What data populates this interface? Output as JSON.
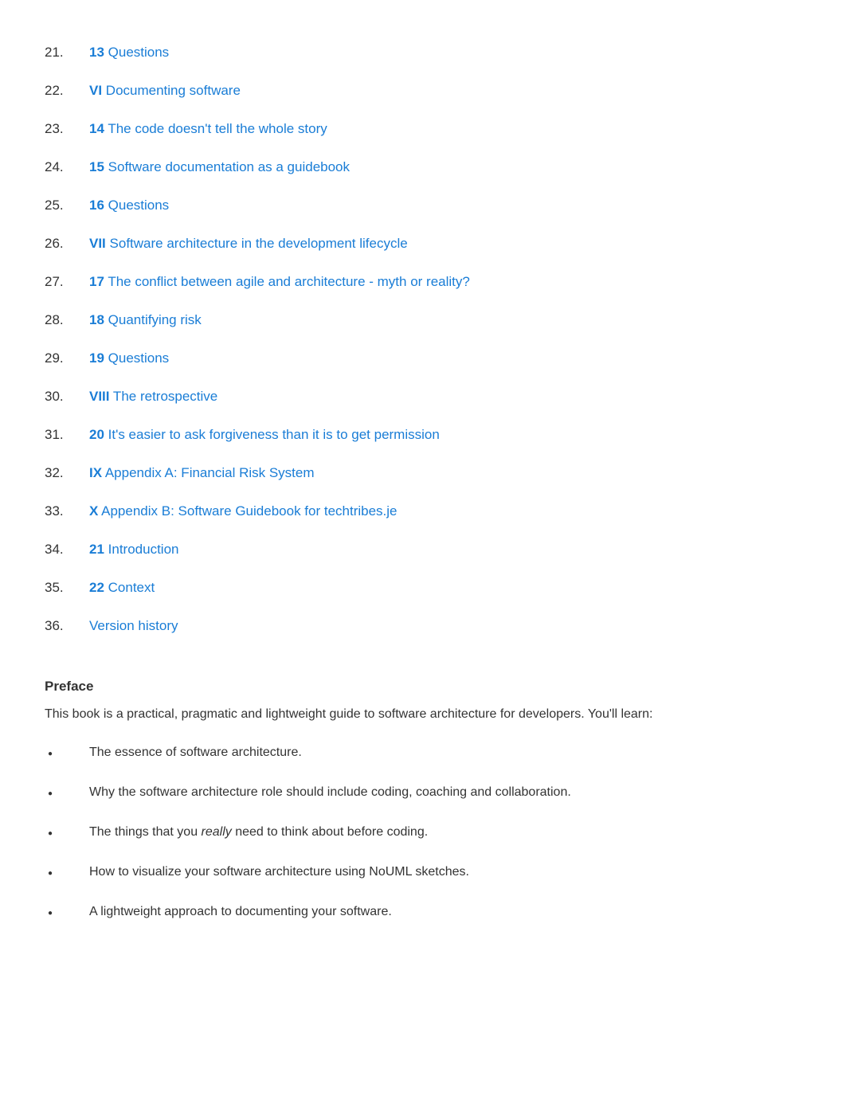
{
  "toc": [
    {
      "num": "21.",
      "prefix": "13",
      "title": " Questions"
    },
    {
      "num": "22.",
      "prefix": "VI",
      "title": " Documenting software"
    },
    {
      "num": "23.",
      "prefix": "14",
      "title": " The code doesn't tell the whole story"
    },
    {
      "num": "24.",
      "prefix": "15",
      "title": " Software documentation as a guidebook"
    },
    {
      "num": "25.",
      "prefix": "16",
      "title": " Questions"
    },
    {
      "num": "26.",
      "prefix": "VII",
      "title": " Software architecture in the development lifecycle"
    },
    {
      "num": "27.",
      "prefix": "17",
      "title": " The conflict between agile and architecture - myth or reality?"
    },
    {
      "num": "28.",
      "prefix": "18",
      "title": " Quantifying risk"
    },
    {
      "num": "29.",
      "prefix": "19",
      "title": " Questions"
    },
    {
      "num": "30.",
      "prefix": "VIII",
      "title": " The retrospective"
    },
    {
      "num": "31.",
      "prefix": "20",
      "title": " It's easier to ask forgiveness than it is to get permission"
    },
    {
      "num": "32.",
      "prefix": "IX",
      "title": " Appendix A: Financial Risk System"
    },
    {
      "num": "33.",
      "prefix": "X",
      "title": " Appendix B: Software Guidebook for techtribes.je"
    },
    {
      "num": "34.",
      "prefix": "21",
      "title": " Introduction"
    },
    {
      "num": "35.",
      "prefix": "22",
      "title": " Context"
    },
    {
      "num": "36.",
      "prefix": "",
      "title": "Version history"
    }
  ],
  "preface": {
    "heading": "Preface",
    "intro": "This book is a practical, pragmatic and lightweight guide to software architecture for developers. You'll learn:",
    "bullets": [
      {
        "text": "The essence of software architecture."
      },
      {
        "text": "Why the software architecture role should include coding, coaching and collaboration."
      },
      {
        "text": "The things that you <em>really</em> need to think about before coding."
      },
      {
        "text": "How to visualize your software architecture using NoUML sketches."
      },
      {
        "text": "A lightweight approach to documenting your software."
      }
    ]
  }
}
